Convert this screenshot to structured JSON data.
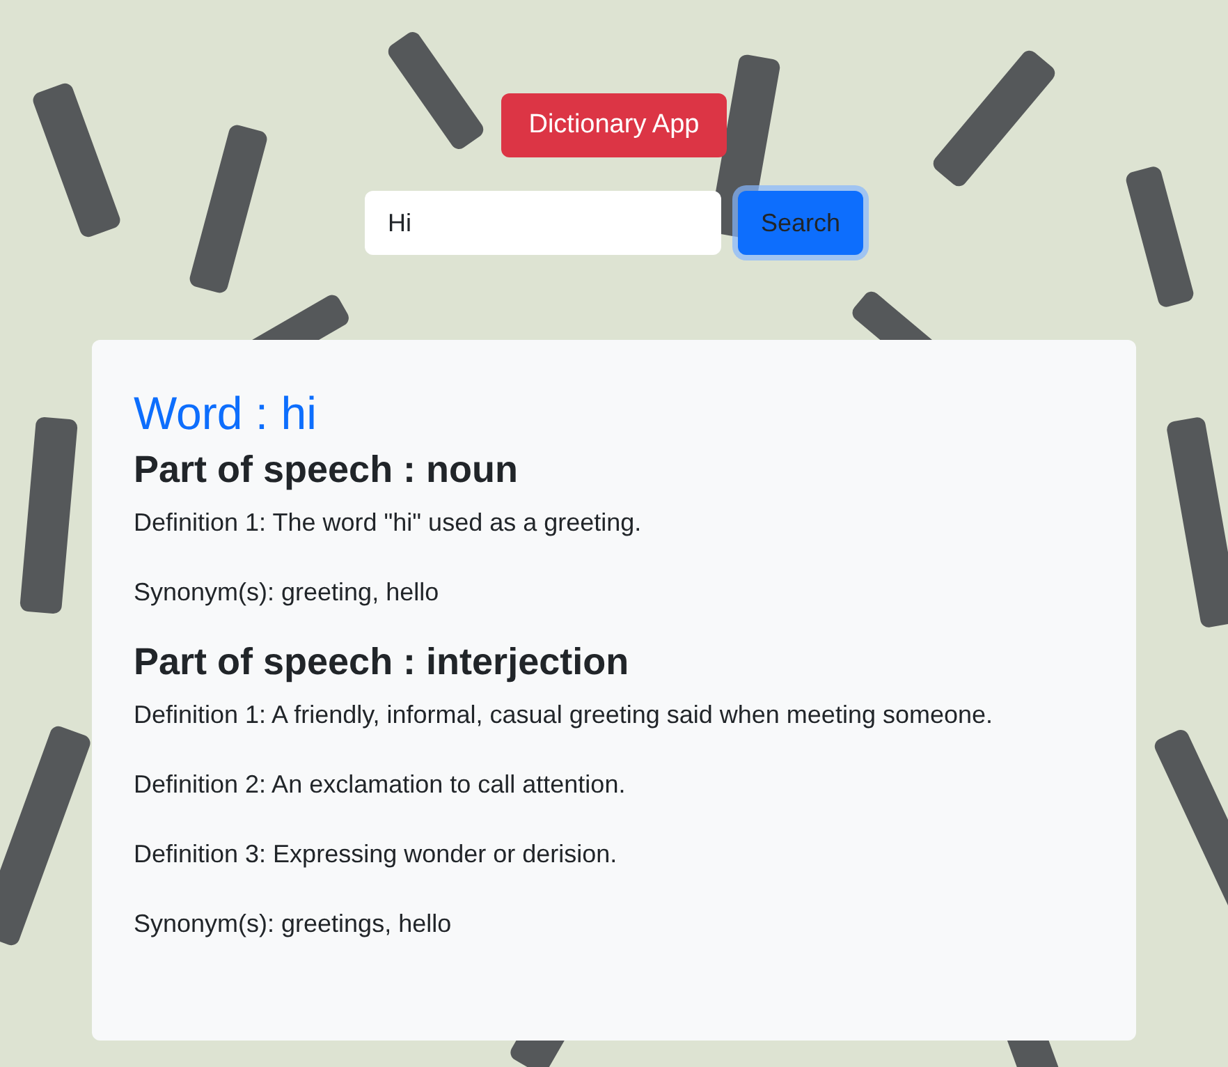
{
  "title_button": "Dictionary App",
  "search": {
    "value": "Hi"
  },
  "search_button": "Search",
  "result": {
    "word_label": "Word : hi",
    "meanings": [
      {
        "heading": "Part of speech : noun",
        "definitions": [
          "Definition 1: The word \"hi\" used as a greeting."
        ],
        "synonyms": "Synonym(s): greeting, hello"
      },
      {
        "heading": "Part of speech : interjection",
        "definitions": [
          "Definition 1: A friendly, informal, casual greeting said when meeting someone.",
          "Definition 2: An exclamation to call attention.",
          "Definition 3: Expressing wonder or derision."
        ],
        "synonyms": "Synonym(s): greetings, hello"
      }
    ]
  }
}
